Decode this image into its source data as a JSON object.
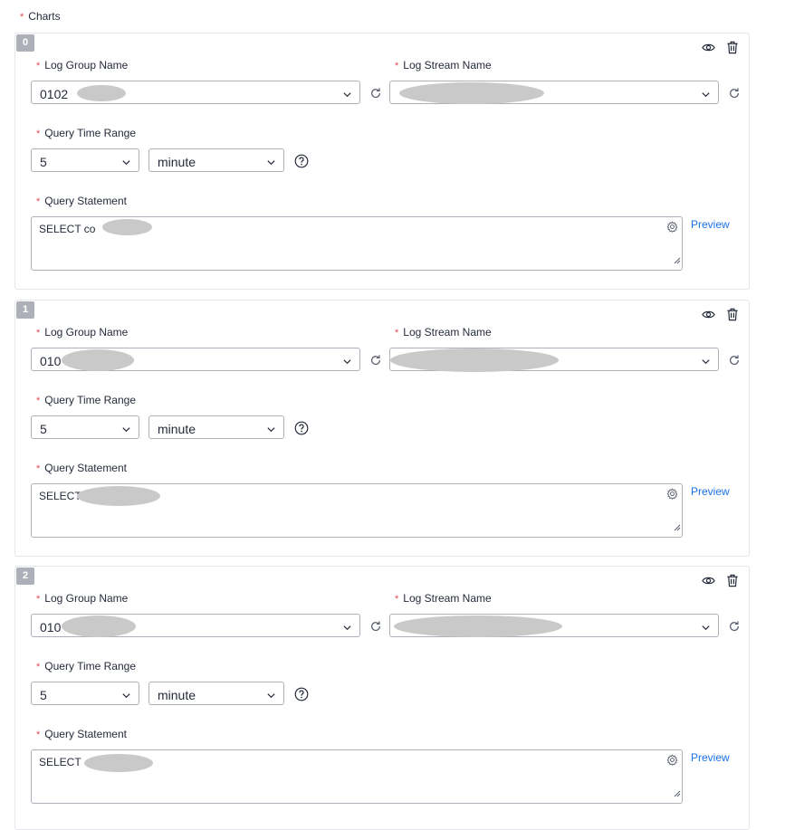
{
  "section": {
    "title": "Charts"
  },
  "labels": {
    "log_group": "Log Group Name",
    "log_stream": "Log Stream Name",
    "time_range": "Query Time Range",
    "statement": "Query Statement",
    "preview": "Preview"
  },
  "charts": [
    {
      "index": "0",
      "log_group": "0102",
      "log_stream": "",
      "time_value": "5",
      "time_unit": "minute",
      "statement": "SELECT co"
    },
    {
      "index": "1",
      "log_group": "010",
      "log_stream": "",
      "time_value": "5",
      "time_unit": "minute",
      "statement": "SELECT"
    },
    {
      "index": "2",
      "log_group": "010",
      "log_stream": "",
      "time_value": "5",
      "time_unit": "minute",
      "statement": "SELECT"
    }
  ],
  "icons": {
    "view": "eye-icon",
    "delete": "trash-icon",
    "refresh": "refresh-icon",
    "dropdown": "chevron-down-icon",
    "help": "question-circle-icon",
    "settings": "gear-icon"
  },
  "colors": {
    "accent": "#1a73e8",
    "required": "#e5484d",
    "badge": "#adb0b8",
    "border": "#adb0b8"
  }
}
